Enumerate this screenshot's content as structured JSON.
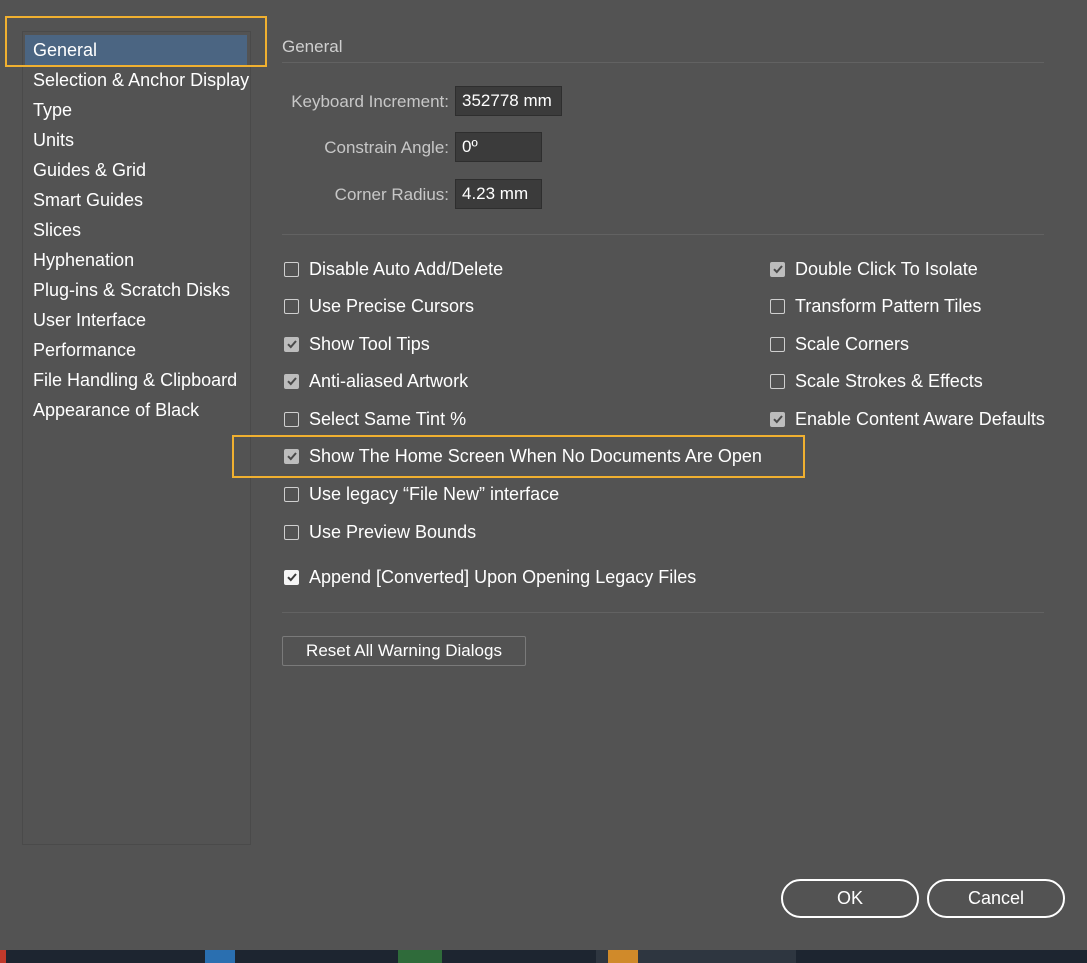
{
  "sidebar": {
    "items": [
      {
        "label": "General"
      },
      {
        "label": "Selection & Anchor Display"
      },
      {
        "label": "Type"
      },
      {
        "label": "Units"
      },
      {
        "label": "Guides & Grid"
      },
      {
        "label": "Smart Guides"
      },
      {
        "label": "Slices"
      },
      {
        "label": "Hyphenation"
      },
      {
        "label": "Plug-ins & Scratch Disks"
      },
      {
        "label": "User Interface"
      },
      {
        "label": "Performance"
      },
      {
        "label": "File Handling & Clipboard"
      },
      {
        "label": "Appearance of Black"
      }
    ]
  },
  "main": {
    "title": "General",
    "fields": {
      "keyboard_increment": {
        "label": "Keyboard Increment:",
        "value": "352778 mm"
      },
      "constrain_angle": {
        "label": "Constrain Angle:",
        "value": "0º"
      },
      "corner_radius": {
        "label": "Corner Radius:",
        "value": "4.23 mm"
      }
    },
    "options_left": [
      {
        "label": "Disable Auto Add/Delete",
        "checked": false
      },
      {
        "label": "Use Precise Cursors",
        "checked": false
      },
      {
        "label": "Show Tool Tips",
        "checked": true
      },
      {
        "label": "Anti-aliased Artwork",
        "checked": true
      },
      {
        "label": "Select Same Tint %",
        "checked": false
      },
      {
        "label": "Show The Home Screen When No Documents Are Open",
        "checked": true
      },
      {
        "label": "Use legacy “File New” interface",
        "checked": false
      },
      {
        "label": "Use Preview Bounds",
        "checked": false
      },
      {
        "label": "Append [Converted] Upon Opening Legacy Files",
        "checked": true
      }
    ],
    "options_right": [
      {
        "label": "Double Click To Isolate",
        "checked": true
      },
      {
        "label": "Transform Pattern Tiles",
        "checked": false
      },
      {
        "label": "Scale Corners",
        "checked": false
      },
      {
        "label": "Scale Strokes & Effects",
        "checked": false
      },
      {
        "label": "Enable Content Aware Defaults",
        "checked": true
      }
    ],
    "reset_label": "Reset All Warning Dialogs"
  },
  "footer": {
    "ok_label": "OK",
    "cancel_label": "Cancel"
  },
  "colors": {
    "background": "#535353",
    "selection": "#4b6582",
    "highlight": "#f0b030"
  }
}
